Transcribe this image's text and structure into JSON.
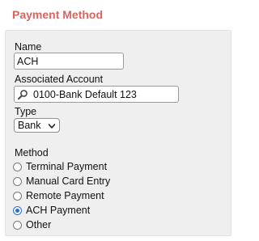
{
  "section": {
    "title": "Payment Method"
  },
  "form": {
    "name_label": "Name",
    "name_value": "ACH",
    "account_label": "Associated Account",
    "account_value": "0100-Bank Default 123",
    "account_icon": "search-icon",
    "type_label": "Type",
    "type_value": "Bank",
    "method_label": "Method",
    "methods": [
      {
        "label": "Terminal Payment",
        "checked": false
      },
      {
        "label": "Manual Card Entry",
        "checked": false
      },
      {
        "label": "Remote Payment",
        "checked": false
      },
      {
        "label": "ACH Payment",
        "checked": true
      },
      {
        "label": "Other",
        "checked": false
      }
    ]
  },
  "colors": {
    "title": "#d9655e",
    "panel_bg": "#efefef",
    "radio_accent": "#2a6fd6"
  }
}
